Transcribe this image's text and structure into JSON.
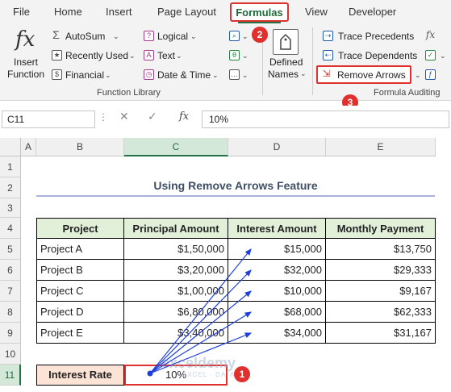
{
  "menu": {
    "file": "File",
    "home": "Home",
    "insert": "Insert",
    "page_layout": "Page Layout",
    "formulas": "Formulas",
    "view": "View",
    "developer": "Developer"
  },
  "ribbon": {
    "insert_function": [
      "Insert",
      "Function"
    ],
    "autosum": "AutoSum",
    "recently_used": "Recently Used",
    "financial": "Financial",
    "logical": "Logical",
    "text": "Text",
    "date_time": "Date & Time",
    "defined_names": [
      "Defined",
      "Names"
    ],
    "trace_precedents": "Trace Precedents",
    "trace_dependents": "Trace Dependents",
    "remove_arrows": "Remove Arrows",
    "group_function_library": "Function Library",
    "group_formula_auditing": "Formula Auditing"
  },
  "badges": {
    "b1": "1",
    "b2": "2",
    "b3": "3"
  },
  "formula_bar": {
    "name_box": "C11",
    "fx": "fx",
    "value": "10%"
  },
  "grid": {
    "columns": [
      "A",
      "B",
      "C",
      "D",
      "E"
    ],
    "rows": [
      "1",
      "2",
      "3",
      "4",
      "5",
      "6",
      "7",
      "8",
      "9",
      "10",
      "11"
    ],
    "selected_column": "C",
    "selected_row": "11"
  },
  "sheet": {
    "title": "Using Remove Arrows Feature",
    "headers": [
      "Project",
      "Principal Amount",
      "Interest Amount",
      "Monthly Payment"
    ],
    "rows": [
      [
        "Project A",
        "$1,50,000",
        "$15,000",
        "$13,750"
      ],
      [
        "Project B",
        "$3,20,000",
        "$32,000",
        "$29,333"
      ],
      [
        "Project C",
        "$1,00,000",
        "$10,000",
        "$9,167"
      ],
      [
        "Project D",
        "$6,80,000",
        "$68,000",
        "$62,333"
      ],
      [
        "Project E",
        "$3,40,000",
        "$34,000",
        "$31,167"
      ]
    ],
    "interest_label": "Interest Rate",
    "interest_value": "10%"
  },
  "watermark": {
    "brand": "exceldemy",
    "tagline": "EXCEL · DATA · BI"
  },
  "colors": {
    "accent_red": "#e0302e",
    "excel_green": "#217346",
    "header_fill": "#e2f0d9",
    "label_fill": "#fbe3d6",
    "arrow_blue": "#1f3fdc"
  }
}
